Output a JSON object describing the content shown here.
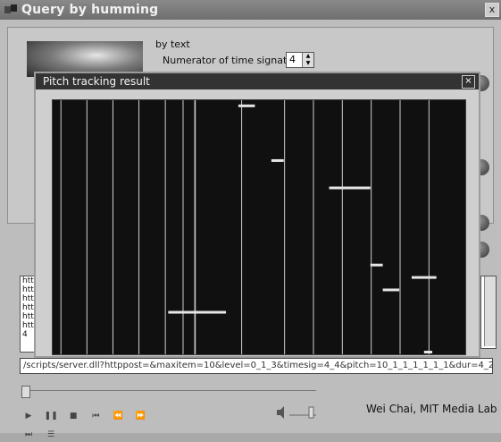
{
  "window": {
    "title": "Query by humming"
  },
  "form": {
    "by_text": "by text",
    "numerator_label": "Numerator of time signature",
    "numerator_value": "4"
  },
  "dialog": {
    "title": "Pitch tracking result",
    "close": "×"
  },
  "pitch_segments": [
    {
      "start": 0.28,
      "end": 0.42,
      "level": 0.16
    },
    {
      "start": 0.45,
      "end": 0.49,
      "level": 0.99
    },
    {
      "start": 0.53,
      "end": 0.56,
      "level": 0.77
    },
    {
      "start": 0.67,
      "end": 0.77,
      "level": 0.66
    },
    {
      "start": 0.77,
      "end": 0.8,
      "level": 0.35
    },
    {
      "start": 0.8,
      "end": 0.84,
      "level": 0.25
    },
    {
      "start": 0.87,
      "end": 0.93,
      "level": 0.3
    },
    {
      "start": 0.9,
      "end": 0.92,
      "level": 0.0
    }
  ],
  "list": {
    "items": [
      "http:",
      "http:",
      "http:",
      "http:",
      "http:",
      "http:",
      "4"
    ]
  },
  "url_field": {
    "value": "/scripts/server.dll?httppost=&maxitem=10&level=0_1_3&timesig=4_4&pitch=10_1_1_1_1_1_1&dur=4_2"
  },
  "player": {
    "controls": [
      "play",
      "pause",
      "stop",
      "prev",
      "rewind",
      "forward",
      "next",
      "playlist"
    ]
  },
  "footer": {
    "credit": "Wei Chai, MIT Media Lab"
  },
  "colors": {
    "plot_bg": "#101010",
    "grid": "#cfcfcf",
    "segment": "#e6e6e6",
    "title_bar": "#333333"
  }
}
